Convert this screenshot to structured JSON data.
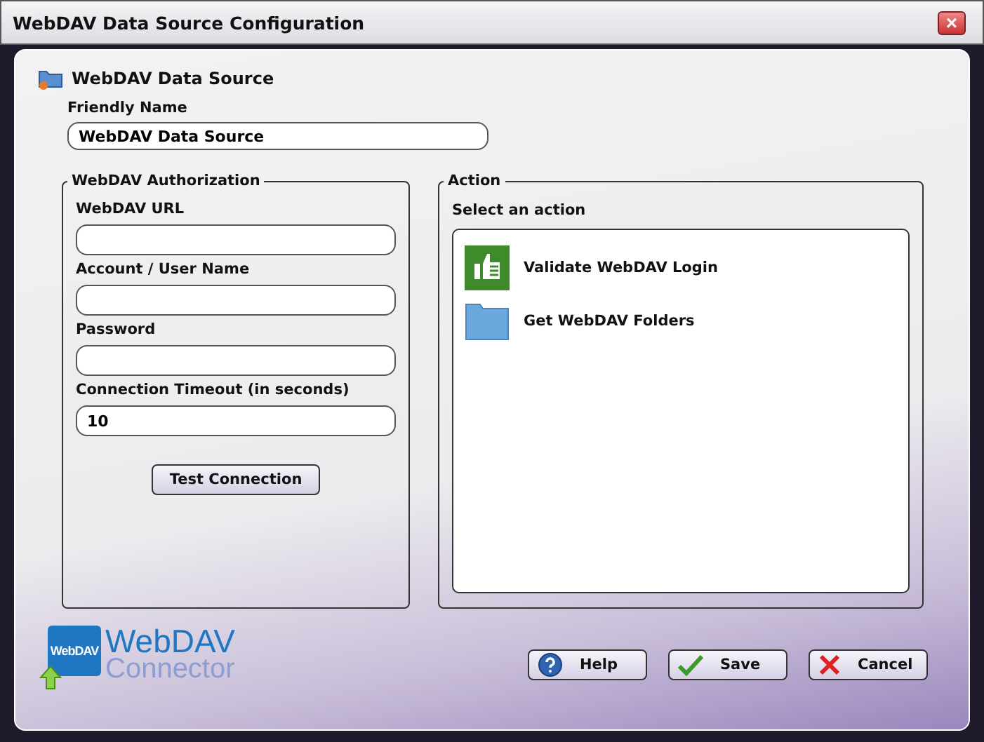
{
  "window": {
    "title": "WebDAV Data Source Configuration",
    "close": "×"
  },
  "header": {
    "title": "WebDAV Data Source"
  },
  "friendly_name": {
    "label": "Friendly Name",
    "value": "WebDAV Data Source"
  },
  "authorization": {
    "legend": "WebDAV Authorization",
    "fields": [
      {
        "label": "WebDAV URL"
      },
      {
        "label": "Account / User Name"
      },
      {
        "label": "Password"
      },
      {
        "label": "Connection Timeout (in seconds)",
        "value": "10"
      }
    ],
    "button": "Test Connection"
  },
  "action": {
    "legend": "Action",
    "prompt": "Select an action",
    "items": [
      {
        "kind": "validate",
        "label": "Validate WebDAV Login"
      },
      {
        "kind": "folders",
        "label": "Get WebDAV Folders"
      }
    ]
  },
  "logo": {
    "badge": "WebDAV",
    "line_1": "WebDAV",
    "line_2": "Connector"
  },
  "buttons": [
    {
      "kind": "help",
      "label": "Help"
    },
    {
      "kind": "save",
      "label": "Save"
    },
    {
      "kind": "cancel",
      "label": "Cancel"
    }
  ]
}
